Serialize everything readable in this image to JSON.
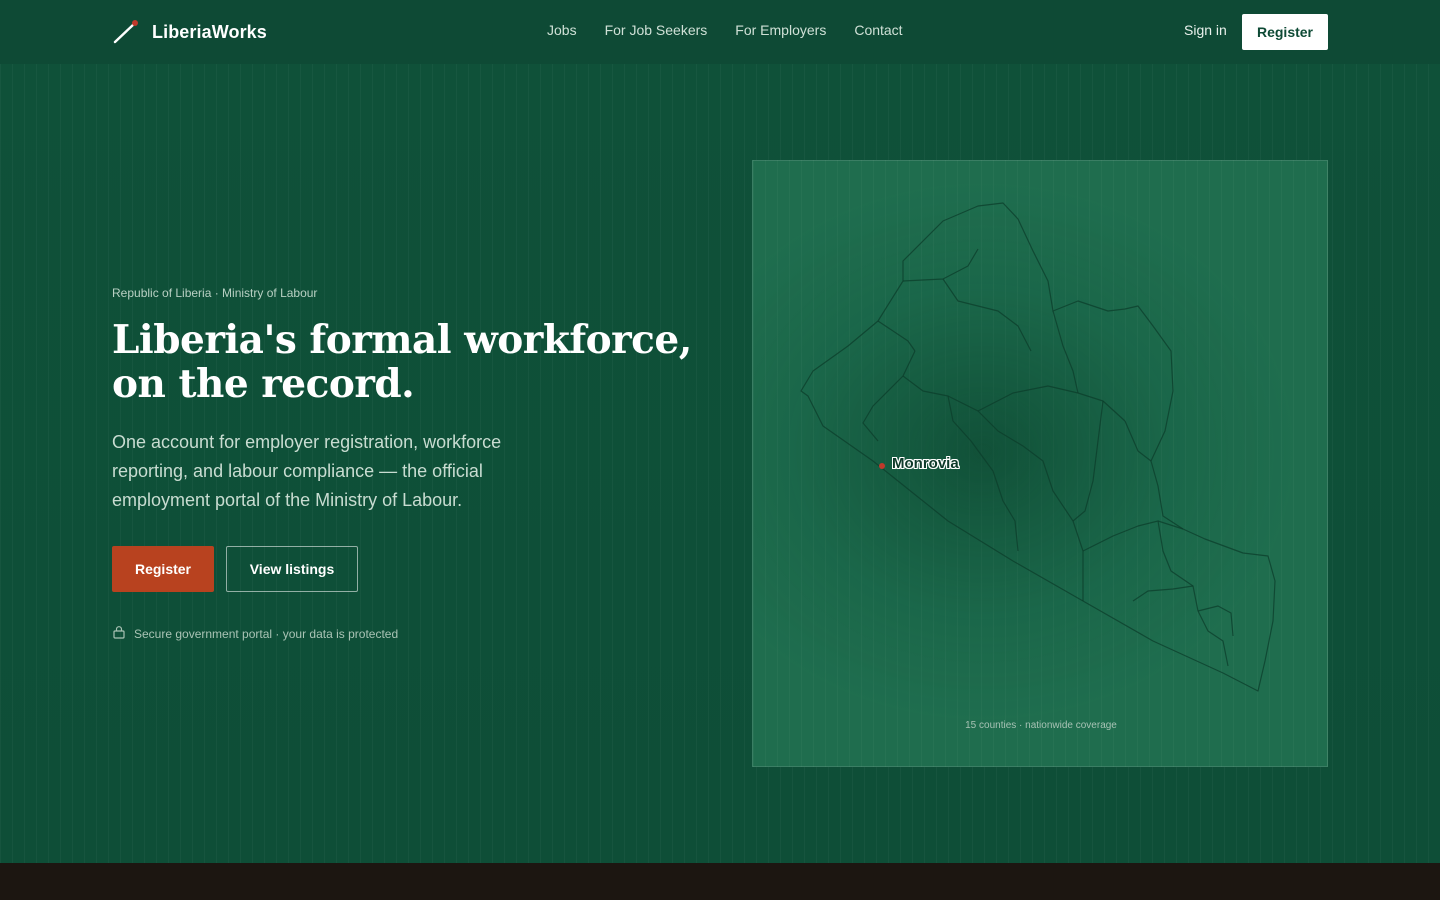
{
  "nav": {
    "brand": "LiberiaWorks",
    "links": [
      {
        "label": "Jobs"
      },
      {
        "label": "For Job Seekers"
      },
      {
        "label": "For Employers"
      },
      {
        "label": "Contact"
      }
    ],
    "sign_in": "Sign in",
    "register": "Register"
  },
  "hero": {
    "eyebrow": "Republic of Liberia · Ministry of Labour",
    "headline": "Liberia's formal workforce, on the record.",
    "subtext": "One account for employer registration, workforce reporting, and labour compliance — the official employment portal of the Ministry of Labour.",
    "primary_cta": "Register",
    "secondary_cta": "View listings",
    "secure_note": "Secure government portal · your data is protected"
  },
  "map": {
    "capital": "Monrovia",
    "coverage": "15 counties · nationwide coverage"
  },
  "colors": {
    "background": "#0f4f38",
    "accent": "#b8421f",
    "footer": "#1c1611"
  },
  "icons": {
    "brand": "slash-logo-icon",
    "secure": "lock-icon"
  }
}
